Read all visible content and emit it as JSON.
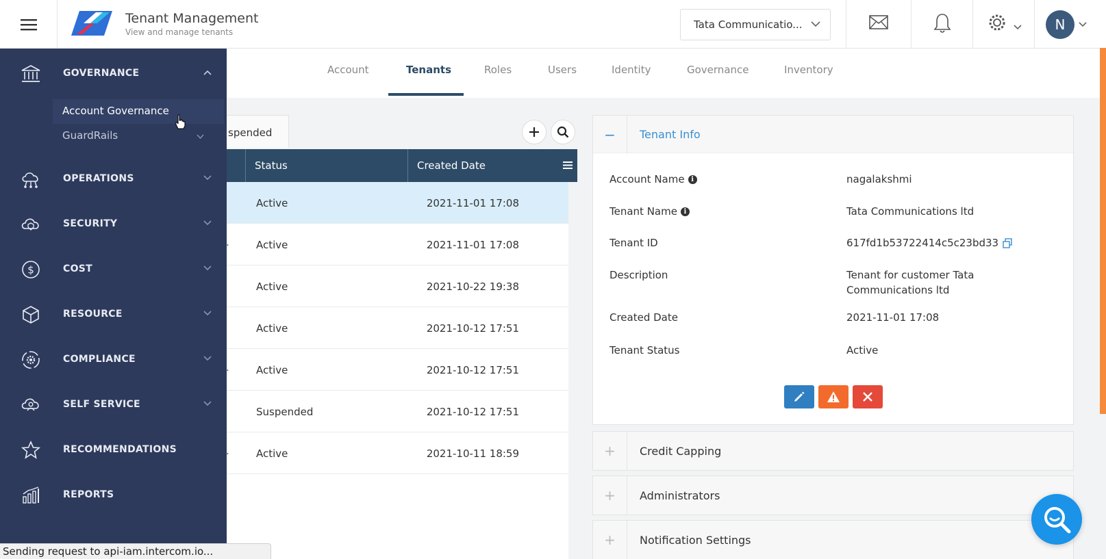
{
  "header": {
    "title": "Tenant Management",
    "subtitle": "View and manage tenants",
    "tenant_selector": "Tata Communicatio...",
    "avatar_initial": "N",
    "icons": [
      "menu-icon",
      "mail-icon",
      "bell-icon",
      "gear-icon",
      "chevron-down-icon"
    ]
  },
  "tabs": [
    {
      "label": "Account"
    },
    {
      "label": "Tenants"
    },
    {
      "label": "Roles"
    },
    {
      "label": "Users"
    },
    {
      "label": "Identity"
    },
    {
      "label": "Governance"
    },
    {
      "label": "Inventory"
    }
  ],
  "active_tab": "Tenants",
  "filter_chip": "spended",
  "table": {
    "columns": [
      "Status",
      "Created Date"
    ],
    "rows": [
      {
        "prefix": "",
        "status": "Active",
        "date": "2021-11-01 17:08",
        "selected": true
      },
      {
        "prefix": ".",
        "status": "Active",
        "date": "2021-11-01 17:08"
      },
      {
        "prefix": "",
        "status": "Active",
        "date": "2021-10-22 19:38"
      },
      {
        "prefix": "",
        "status": "Active",
        "date": "2021-10-12 17:51"
      },
      {
        "prefix": ".",
        "status": "Active",
        "date": "2021-10-12 17:51"
      },
      {
        "prefix": "",
        "status": "Suspended",
        "date": "2021-10-12 17:51"
      },
      {
        "prefix": ".",
        "status": "Active",
        "date": "2021-10-11 18:59"
      }
    ]
  },
  "tenant_info": {
    "title": "Tenant Info",
    "fields": [
      {
        "label": "Account Name",
        "value": "nagalakshmi"
      },
      {
        "label": "Tenant Name",
        "value": "Tata Communications ltd"
      },
      {
        "label": "Tenant ID",
        "value": "617fd1b53722414c5c23bd33"
      },
      {
        "label": "Description",
        "value": "Tenant for customer Tata Communications ltd"
      },
      {
        "label": "Created Date",
        "value": "2021-11-01 17:08"
      },
      {
        "label": "Tenant Status",
        "value": "Active"
      }
    ],
    "collapse_symbol": "−"
  },
  "accordions": [
    {
      "title": "Credit Capping",
      "symbol": "+"
    },
    {
      "title": "Administrators",
      "symbol": "+"
    },
    {
      "title": "Notification Settings",
      "symbol": "+"
    }
  ],
  "sidebar": {
    "sections": [
      {
        "label": "GOVERNANCE",
        "icon": "bank-icon",
        "expanded": true
      },
      {
        "label": "OPERATIONS",
        "icon": "cloud-network-icon"
      },
      {
        "label": "SECURITY",
        "icon": "cloud-shield-icon"
      },
      {
        "label": "COST",
        "icon": "dollar-icon"
      },
      {
        "label": "RESOURCE",
        "icon": "cube-icon"
      },
      {
        "label": "COMPLIANCE",
        "icon": "compliance-gear-icon"
      },
      {
        "label": "SELF SERVICE",
        "icon": "self-service-icon"
      },
      {
        "label": "RECOMMENDATIONS",
        "icon": "star-icon"
      },
      {
        "label": "REPORTS",
        "icon": "bar-chart-icon"
      }
    ],
    "sub_items": [
      {
        "label": "Account Governance"
      },
      {
        "label": "GuardRails"
      }
    ]
  },
  "status_bar": "Sending request to api-iam.intercom.io...",
  "colors": {
    "sidebar_bg": "#2d3a5c",
    "table_header": "#2d4b66",
    "accent_blue": "#3a8fd0",
    "selected_row": "#d9eefa",
    "edit_btn": "#2f7fc1",
    "warn_btn": "#f26b2d",
    "delete_btn": "#e5493a",
    "fab": "#1a93e8"
  }
}
